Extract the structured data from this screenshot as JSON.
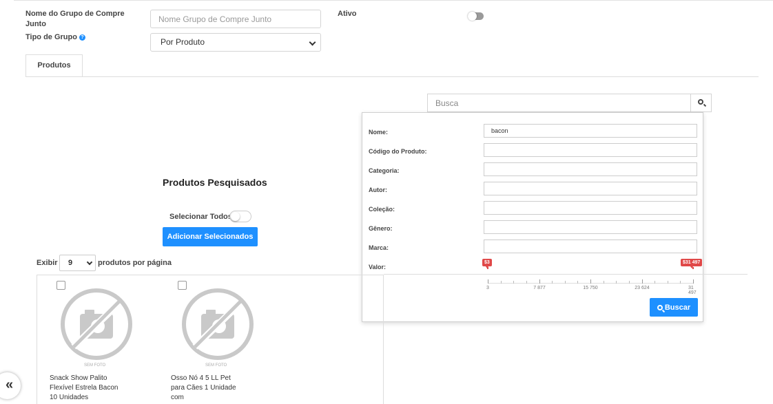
{
  "form": {
    "group_name_label": "Nome do Grupo de Compre Junto",
    "group_name_placeholder": "Nome Grupo de Compre Junto",
    "group_type_label": "Tipo de Grupo",
    "group_type_value": "Por Produto",
    "active_label": "Ativo"
  },
  "tabs": [
    {
      "label": "Produtos"
    }
  ],
  "search": {
    "placeholder": "Busca",
    "filters": {
      "nome_label": "Nome:",
      "nome_value": "bacon",
      "codigo_label": "Código do Produto:",
      "categoria_label": "Categoria:",
      "autor_label": "Autor:",
      "colecao_label": "Coleção:",
      "genero_label": "Gênero:",
      "marca_label": "Marca:",
      "valor_label": "Valor:"
    },
    "price_range": {
      "min_flag": "$3",
      "max_flag": "$31 497",
      "ticks": [
        "3",
        "7 877",
        "15 750",
        "23 624",
        "31 497"
      ]
    },
    "buscar_label": "Buscar"
  },
  "results": {
    "title": "Produtos Pesquisados",
    "select_all_label": "Selecionar Todos",
    "add_selected_label": "Adicionar Selecionados",
    "show_label": "Exibir",
    "per_page_value": "9",
    "per_page_label": "produtos por página",
    "no_photo_text": "SEM FOTO",
    "products": [
      {
        "name": "Snack Show Palito Flexível Estrela Bacon 10 Unidades"
      },
      {
        "name": "Osso Nó 4 5 LL Pet para Cães 1 Unidade com"
      }
    ]
  },
  "sidebar_toggle_icon": "double-chevron-left-icon",
  "colors": {
    "accent": "#1e90ff",
    "range_flag": "#e04848"
  }
}
